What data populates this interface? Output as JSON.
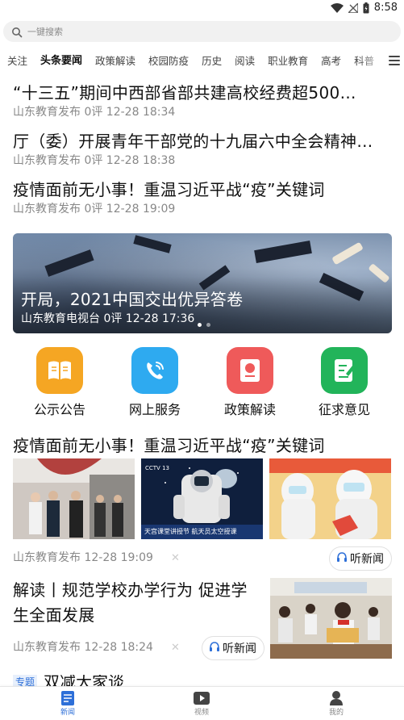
{
  "status_bar": {
    "time": "8:58"
  },
  "search": {
    "placeholder": "一键搜索"
  },
  "tabs": [
    {
      "label": "关注",
      "active": false
    },
    {
      "label": "头条要闻",
      "active": true
    },
    {
      "label": "政策解读",
      "active": false
    },
    {
      "label": "校园防疫",
      "active": false
    },
    {
      "label": "历史",
      "active": false
    },
    {
      "label": "阅读",
      "active": false
    },
    {
      "label": "职业教育",
      "active": false
    },
    {
      "label": "高考",
      "active": false
    },
    {
      "label": "科普",
      "active": false
    }
  ],
  "news_list": [
    {
      "title": "“十三五”期间中西部省部共建高校经费超500…",
      "meta": "山东教育发布 0评 12-28 18:34"
    },
    {
      "title": "厅（委）开展青年干部党的十九届六中全会精神…",
      "meta": "山东教育发布 0评 12-28 18:38"
    },
    {
      "title": "疫情面前无小事！重温习近平战“疫”关键词",
      "meta": "山东教育发布 0评 12-28 19:09"
    }
  ],
  "banner": {
    "title": "开局，2021中国交出优异答卷",
    "meta": "山东教育电视台 0评 12-28 17:36"
  },
  "quick_entries": [
    {
      "label": "公示公告",
      "icon": "book-icon",
      "color": "#f5a623"
    },
    {
      "label": "网上服务",
      "icon": "phone-icon",
      "color": "#2eaaf0"
    },
    {
      "label": "政策解读",
      "icon": "policy-icon",
      "color": "#ef5a5a"
    },
    {
      "label": "征求意见",
      "icon": "edit-note-icon",
      "color": "#22b45a"
    }
  ],
  "image_news": {
    "title": "疫情面前无小事！重温习近平战“疫”关键词",
    "meta": "山东教育发布 12-28 19:09",
    "listen_label": "听新闻",
    "thumb2_caption": "天宫课堂讲授节 航天员太空授课"
  },
  "article2": {
    "title": "解读丨规范学校办学行为 促进学生全面发展",
    "meta": "山东教育发布 12-28 18:24",
    "listen_label": "听新闻"
  },
  "topic": {
    "tag": "专题",
    "title": "双减大家谈"
  },
  "bottom_nav": [
    {
      "label": "新闻",
      "icon": "news-icon",
      "active": true
    },
    {
      "label": "视频",
      "icon": "video-icon",
      "active": false
    },
    {
      "label": "我的",
      "icon": "profile-icon",
      "active": false
    }
  ],
  "colors": {
    "accent": "#2d6fd8",
    "meta_text": "#888888"
  }
}
